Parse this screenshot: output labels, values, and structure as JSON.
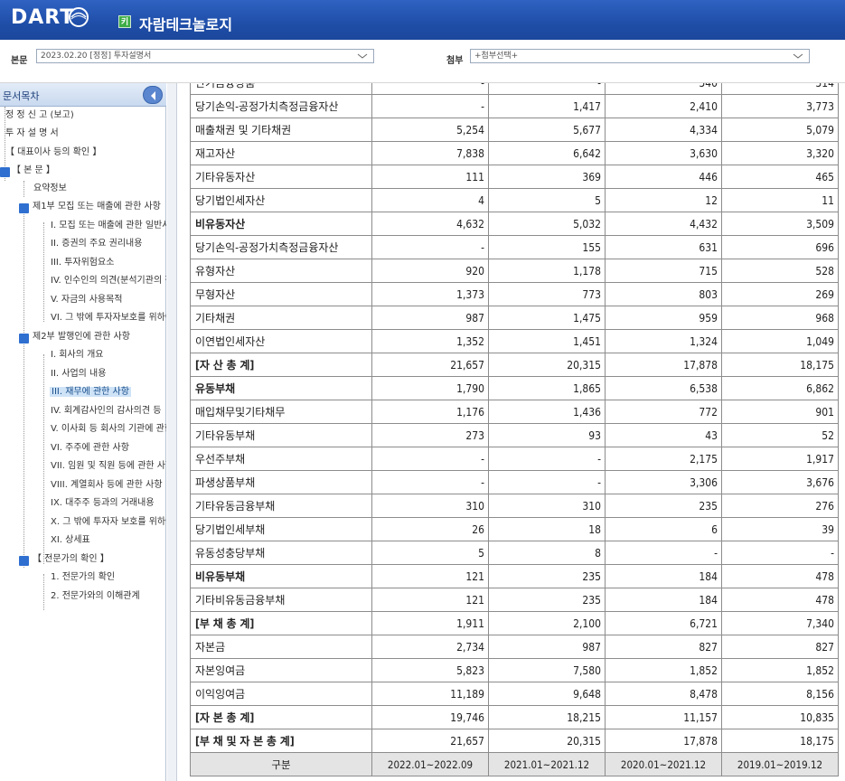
{
  "header": {
    "logo_text": "DART",
    "company_icon": "키",
    "company_name": "자람테크놀로지"
  },
  "toolbar": {
    "main_label": "본문",
    "main_select": "2023.02.20  [정정] 투자설명서",
    "attach_label": "첨부",
    "attach_select": "+첨부선택+"
  },
  "sidebar": {
    "title": "문서목차",
    "items": [
      {
        "label": "정 정 신 고 (보고)"
      },
      {
        "label": "투 자 설 명 서"
      },
      {
        "label": "【 대표이사 등의 확인 】"
      },
      {
        "label": "【 본 문 】"
      },
      {
        "label": "요약정보"
      },
      {
        "label": "제1부 모집 또는 매출에 관한 사항"
      },
      {
        "label": "I. 모집 또는 매출에 관한 일반사항"
      },
      {
        "label": "II. 증권의 주요 권리내용"
      },
      {
        "label": "III. 투자위험요소"
      },
      {
        "label": "IV. 인수인의 의견(분석기관의 평가의견)"
      },
      {
        "label": "V. 자금의 사용목적"
      },
      {
        "label": "VI. 그 밖에 투자자보호를 위하여 필요한 사항"
      },
      {
        "label": "제2부 발행인에 관한 사항"
      },
      {
        "label": "I. 회사의 개요"
      },
      {
        "label": "II. 사업의 내용"
      },
      {
        "label": "III. 재무에 관한 사항"
      },
      {
        "label": "IV. 회계감사인의 감사의견 등"
      },
      {
        "label": "V. 이사회 등 회사의 기관에 관한 사항"
      },
      {
        "label": "VI. 주주에 관한 사항"
      },
      {
        "label": "VII. 임원 및 직원 등에 관한 사항"
      },
      {
        "label": "VIII. 계열회사 등에 관한 사항"
      },
      {
        "label": "IX. 대주주 등과의 거래내용"
      },
      {
        "label": "X. 그 밖에 투자자 보호를 위하여 필요한 사항"
      },
      {
        "label": "XI. 상세표"
      },
      {
        "label": "【 전문가의 확인 】"
      },
      {
        "label": "1. 전문가의 확인"
      },
      {
        "label": "2. 전문가와의 이해관계"
      }
    ]
  },
  "table": {
    "rows": [
      {
        "label": "단기금융상품",
        "v": [
          "-",
          "-",
          "540",
          "514"
        ]
      },
      {
        "label": "당기손익-공정가치측정금융자산",
        "v": [
          "-",
          "1,417",
          "2,410",
          "3,773"
        ]
      },
      {
        "label": "매출채권 및 기타채권",
        "v": [
          "5,254",
          "5,677",
          "4,334",
          "5,079"
        ]
      },
      {
        "label": "재고자산",
        "v": [
          "7,838",
          "6,642",
          "3,630",
          "3,320"
        ]
      },
      {
        "label": "기타유동자산",
        "v": [
          "111",
          "369",
          "446",
          "465"
        ]
      },
      {
        "label": "당기법인세자산",
        "v": [
          "4",
          "5",
          "12",
          "11"
        ]
      },
      {
        "label": "비유동자산",
        "v": [
          "4,632",
          "5,032",
          "4,432",
          "3,509"
        ]
      },
      {
        "label": "당기손익-공정가치측정금융자산",
        "v": [
          "-",
          "155",
          "631",
          "696"
        ]
      },
      {
        "label": "유형자산",
        "v": [
          "920",
          "1,178",
          "715",
          "528"
        ]
      },
      {
        "label": "무형자산",
        "v": [
          "1,373",
          "773",
          "803",
          "269"
        ]
      },
      {
        "label": "기타채권",
        "v": [
          "987",
          "1,475",
          "959",
          "968"
        ]
      },
      {
        "label": "이연법인세자산",
        "v": [
          "1,352",
          "1,451",
          "1,324",
          "1,049"
        ]
      },
      {
        "label": "[자 산 총 계]",
        "v": [
          "21,657",
          "20,315",
          "17,878",
          "18,175"
        ]
      },
      {
        "label": "유동부채",
        "v": [
          "1,790",
          "1,865",
          "6,538",
          "6,862"
        ]
      },
      {
        "label": "매입채무및기타채무",
        "v": [
          "1,176",
          "1,436",
          "772",
          "901"
        ]
      },
      {
        "label": "기타유동부채",
        "v": [
          "273",
          "93",
          "43",
          "52"
        ]
      },
      {
        "label": "우선주부채",
        "v": [
          "-",
          "-",
          "2,175",
          "1,917"
        ]
      },
      {
        "label": "파생상품부채",
        "v": [
          "-",
          "-",
          "3,306",
          "3,676"
        ]
      },
      {
        "label": "기타유동금융부채",
        "v": [
          "310",
          "310",
          "235",
          "276"
        ]
      },
      {
        "label": "당기법인세부채",
        "v": [
          "26",
          "18",
          "6",
          "39"
        ]
      },
      {
        "label": "유동성충당부채",
        "v": [
          "5",
          "8",
          "-",
          "-"
        ]
      },
      {
        "label": "비유동부채",
        "v": [
          "121",
          "235",
          "184",
          "478"
        ]
      },
      {
        "label": "기타비유동금융부채",
        "v": [
          "121",
          "235",
          "184",
          "478"
        ]
      },
      {
        "label": "[부 채 총 계]",
        "v": [
          "1,911",
          "2,100",
          "6,721",
          "7,340"
        ]
      },
      {
        "label": "자본금",
        "v": [
          "2,734",
          "987",
          "827",
          "827"
        ]
      },
      {
        "label": "자본잉여금",
        "v": [
          "5,823",
          "7,580",
          "1,852",
          "1,852"
        ]
      },
      {
        "label": "이익잉여금",
        "v": [
          "11,189",
          "9,648",
          "8,478",
          "8,156"
        ]
      },
      {
        "label": "[자 본 총 계]",
        "v": [
          "19,746",
          "18,215",
          "11,157",
          "10,835"
        ]
      },
      {
        "label": "[부 채 및 자 본 총 계]",
        "v": [
          "21,657",
          "20,315",
          "17,878",
          "18,175"
        ]
      }
    ],
    "header": {
      "label": "구분",
      "v": [
        "2022.01~2022.09",
        "2021.01~2021.12",
        "2020.01~2021.12",
        "2019.01~2019.12"
      ]
    }
  }
}
